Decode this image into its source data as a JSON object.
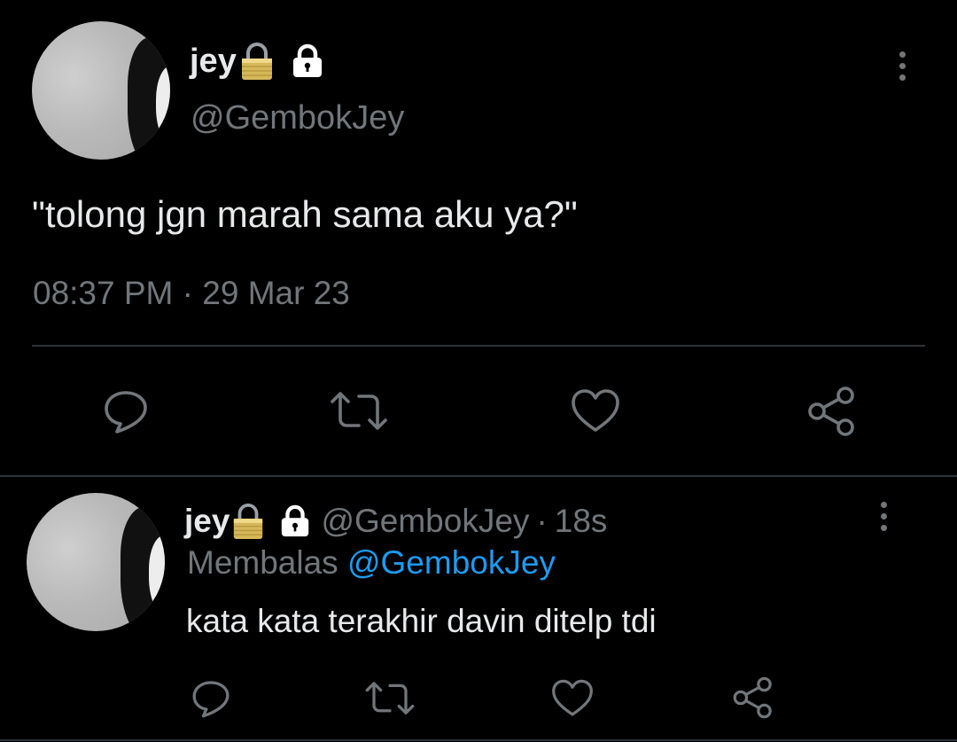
{
  "main_tweet": {
    "display_name": "jey",
    "handle": "@GembokJey",
    "text": "\"tolong jgn marah sama aku ya?\"",
    "time": "08:37 PM",
    "separator": "·",
    "date": "29 Mar 23",
    "icons": [
      "gold-padlock-icon",
      "lock-icon",
      "more-icon",
      "reply-icon",
      "retweet-icon",
      "like-icon",
      "share-icon"
    ]
  },
  "reply_tweet": {
    "display_name": "jey",
    "handle": "@GembokJey",
    "separator": "·",
    "age": "18s",
    "replying_label": "Membalas",
    "replying_to": "@GembokJey",
    "text": "kata kata terakhir davin ditelp tdi"
  },
  "colors": {
    "background": "#000000",
    "text": "#e7e9ea",
    "muted": "#71767b",
    "link": "#1d9bf0",
    "divider": "#2f3336"
  }
}
